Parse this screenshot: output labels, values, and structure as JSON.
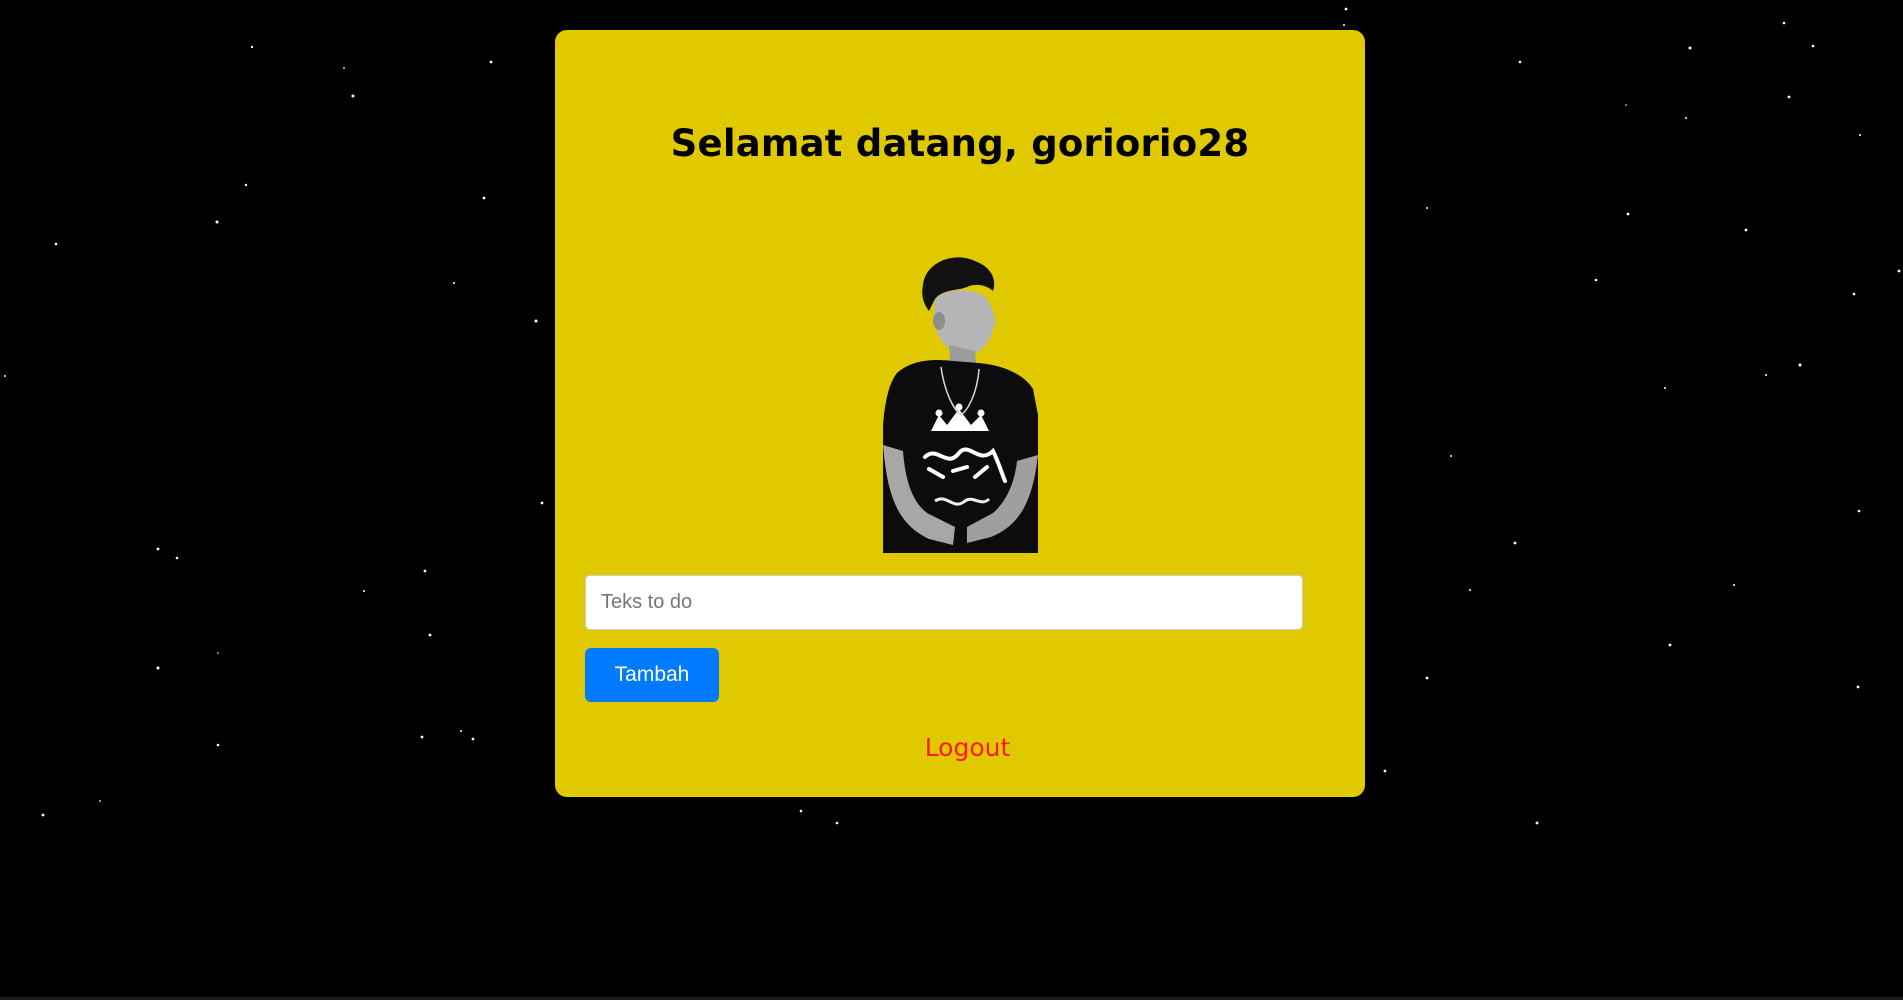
{
  "colors": {
    "background": "#000000",
    "card": "#e0c900",
    "primary_button": "#007bff",
    "logout_link": "#ff1a1a"
  },
  "header": {
    "title": "Selamat datang, goriorio28"
  },
  "avatar": {
    "icon": "person-photo"
  },
  "todo_form": {
    "input_value": "",
    "input_placeholder": "Teks to do",
    "add_button_label": "Tambah"
  },
  "footer": {
    "logout_label": "Logout"
  }
}
